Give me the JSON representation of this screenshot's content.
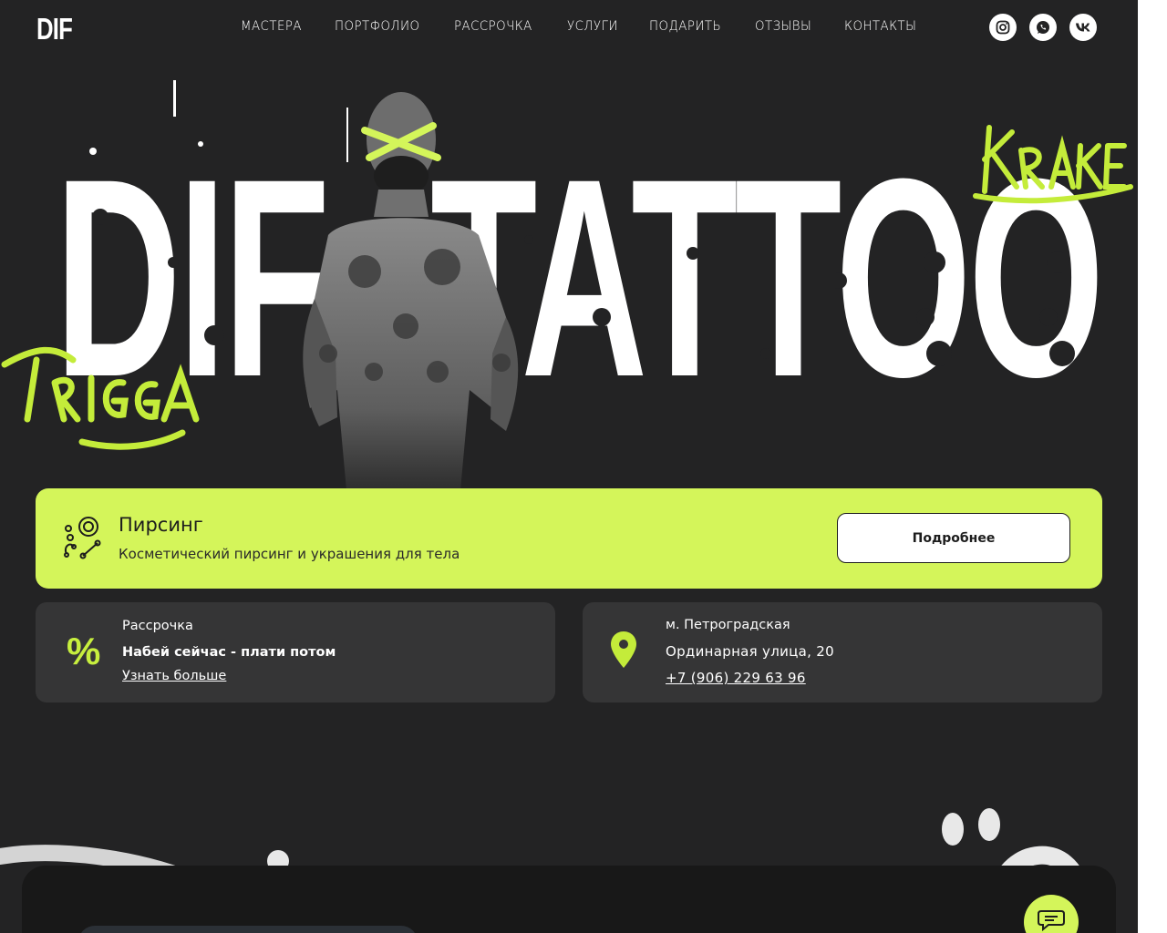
{
  "header": {
    "logo": "DIF",
    "nav": [
      "МАСТЕРА",
      "ПОРТФОЛИО",
      "РАССРОЧКА",
      "УСЛУГИ",
      "ПОДАРИТЬ",
      "ОТЗЫВЫ",
      "КОНТАКТЫ"
    ],
    "socials": [
      "instagram-icon",
      "whatsapp-icon",
      "vk-icon"
    ]
  },
  "hero": {
    "title_left": "DIF",
    "title_right": "TATTOO",
    "tag_left": "TRIGGA",
    "tag_right": "KRAKEN",
    "accent": "#d4f55a"
  },
  "banner": {
    "title": "Пирсинг",
    "subtitle": "Косметический пирсинг и украшения для тела",
    "button": "Подробнее"
  },
  "installment": {
    "symbol": "%",
    "label": "Рассрочка",
    "headline": "Набей сейчас - плати потом",
    "link": "Узнать больше"
  },
  "location": {
    "metro": "м. Петроградская",
    "address": "Ординарная улица, 20",
    "phone": "+7 (906) 229 63 96"
  },
  "colors": {
    "background": "#232324",
    "card": "#353536",
    "accent": "#d4f55a"
  }
}
